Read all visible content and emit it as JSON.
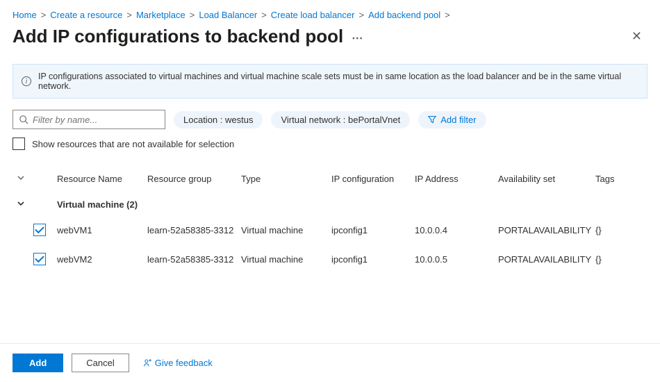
{
  "breadcrumb": {
    "items": [
      {
        "label": "Home"
      },
      {
        "label": "Create a resource"
      },
      {
        "label": "Marketplace"
      },
      {
        "label": "Load Balancer"
      },
      {
        "label": "Create load balancer"
      },
      {
        "label": "Add backend pool"
      }
    ]
  },
  "header": {
    "title": "Add IP configurations to backend pool"
  },
  "banner": {
    "text": "IP configurations associated to virtual machines and virtual machine scale sets must be in same location as the load balancer and be in the same virtual network."
  },
  "filter": {
    "placeholder": "Filter by name...",
    "pills": {
      "location": "Location : westus",
      "vnet": "Virtual network : bePortalVnet",
      "add": "Add filter"
    },
    "show_unavailable_label": "Show resources that are not available for selection"
  },
  "columns": {
    "resource_name": "Resource Name",
    "resource_group": "Resource group",
    "type": "Type",
    "ip_config": "IP configuration",
    "ip_address": "IP Address",
    "availability": "Availability set",
    "tags": "Tags"
  },
  "group": {
    "label": "Virtual machine (2)"
  },
  "rows": [
    {
      "name": "webVM1",
      "rg": "learn-52a58385-3312",
      "type": "Virtual machine",
      "ip_config": "ipconfig1",
      "ip_address": "10.0.0.4",
      "availability": "PORTALAVAILABILITY",
      "tags": "{}"
    },
    {
      "name": "webVM2",
      "rg": "learn-52a58385-3312",
      "type": "Virtual machine",
      "ip_config": "ipconfig1",
      "ip_address": "10.0.0.5",
      "availability": "PORTALAVAILABILITY",
      "tags": "{}"
    }
  ],
  "footer": {
    "add": "Add",
    "cancel": "Cancel",
    "feedback": "Give feedback"
  }
}
